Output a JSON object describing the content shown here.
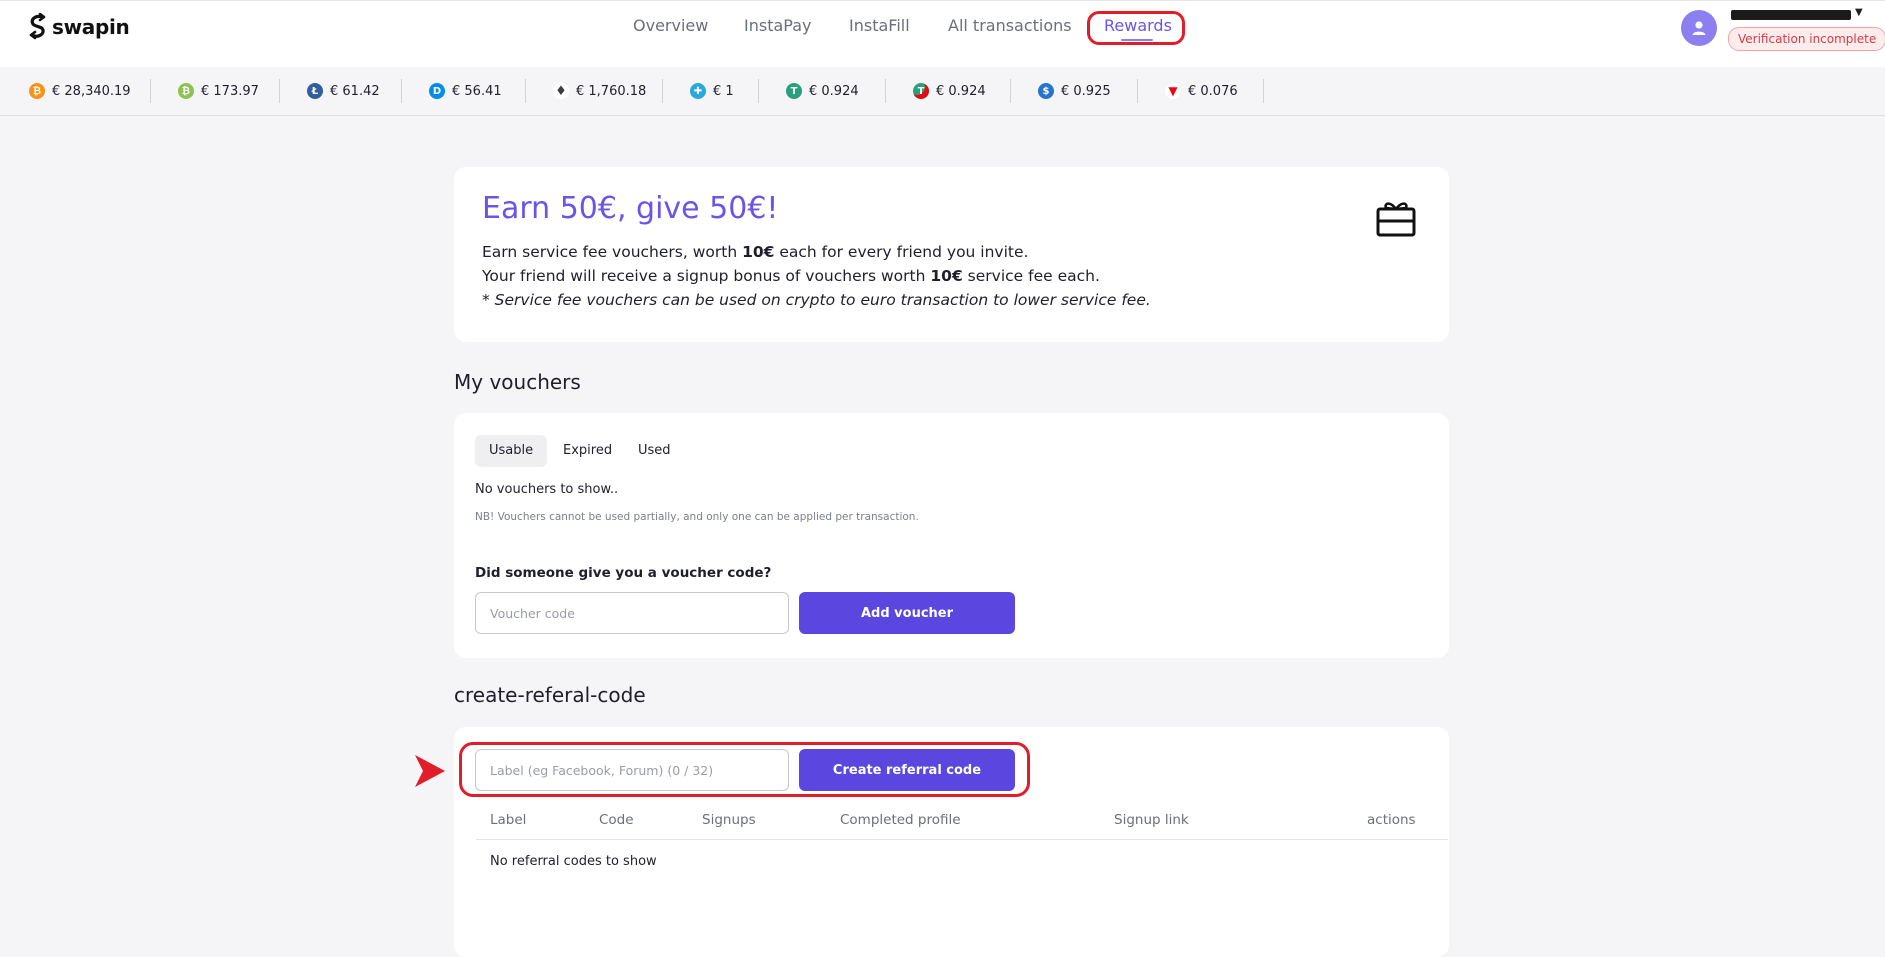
{
  "header": {
    "logo": "swapin",
    "nav": [
      "Overview",
      "InstaPay",
      "InstaFill",
      "All transactions",
      "Rewards"
    ],
    "active_nav": "Rewards",
    "verification_badge": "Verification incomplete"
  },
  "ticker": [
    {
      "icon": "bitcoin-icon",
      "color": "#f7931a",
      "glyph": "₿",
      "price": "€ 28,340.19"
    },
    {
      "icon": "bitcoin-cash-icon",
      "color": "#8dc351",
      "glyph": "₿",
      "price": "€ 173.97"
    },
    {
      "icon": "litecoin-icon",
      "color": "#345d9d",
      "glyph": "Ł",
      "price": "€ 61.42"
    },
    {
      "icon": "dash-icon",
      "color": "#008ce7",
      "glyph": "D",
      "price": "€ 56.41"
    },
    {
      "icon": "ethereum-icon",
      "color": "#3c3c3d",
      "glyph": "♦",
      "price": "€ 1,760.18"
    },
    {
      "icon": "usdc-plus-icon",
      "color": "#2aa8dd",
      "glyph": "✚",
      "price": "€ 1"
    },
    {
      "icon": "tether-icon",
      "color": "#26a17b",
      "glyph": "T",
      "price": "€ 0.924"
    },
    {
      "icon": "tether-tron-icon",
      "color": "#26a17b",
      "glyph": "T",
      "price": "€ 0.924"
    },
    {
      "icon": "usd-coin-icon",
      "color": "#2775ca",
      "glyph": "$",
      "price": "€ 0.925"
    },
    {
      "icon": "tron-icon",
      "color": "#e50915",
      "glyph": "▼",
      "price": "€ 0.076"
    }
  ],
  "hero": {
    "title": "Earn 50€, give 50€!",
    "line1_pre": "Earn service fee vouchers, worth ",
    "line1_bold": "10€",
    "line1_post": " each for every friend you invite.",
    "line2_pre": "Your friend will receive a signup bonus of vouchers worth ",
    "line2_bold": "10€",
    "line2_post": " service fee each.",
    "line3": "* Service fee vouchers can be used on crypto to euro transaction to lower service fee."
  },
  "vouchers": {
    "title": "My vouchers",
    "tabs": [
      "Usable",
      "Expired",
      "Used"
    ],
    "active_tab": "Usable",
    "empty_text": "No vouchers to show..",
    "note": "NB! Vouchers cannot be used partially, and only one can be applied per transaction.",
    "question": "Did someone give you a voucher code?",
    "input_placeholder": "Voucher code",
    "button": "Add voucher"
  },
  "referral": {
    "title": "create-referal-code",
    "input_placeholder": "Label (eg Facebook, Forum) (0 / 32)",
    "button": "Create referral code",
    "columns": [
      "Label",
      "Code",
      "Signups",
      "Completed profile",
      "Signup link",
      "actions"
    ],
    "empty_text": "No referral codes to show"
  },
  "colors": {
    "accent": "#5b46e0",
    "highlight": "#e11d2a"
  }
}
